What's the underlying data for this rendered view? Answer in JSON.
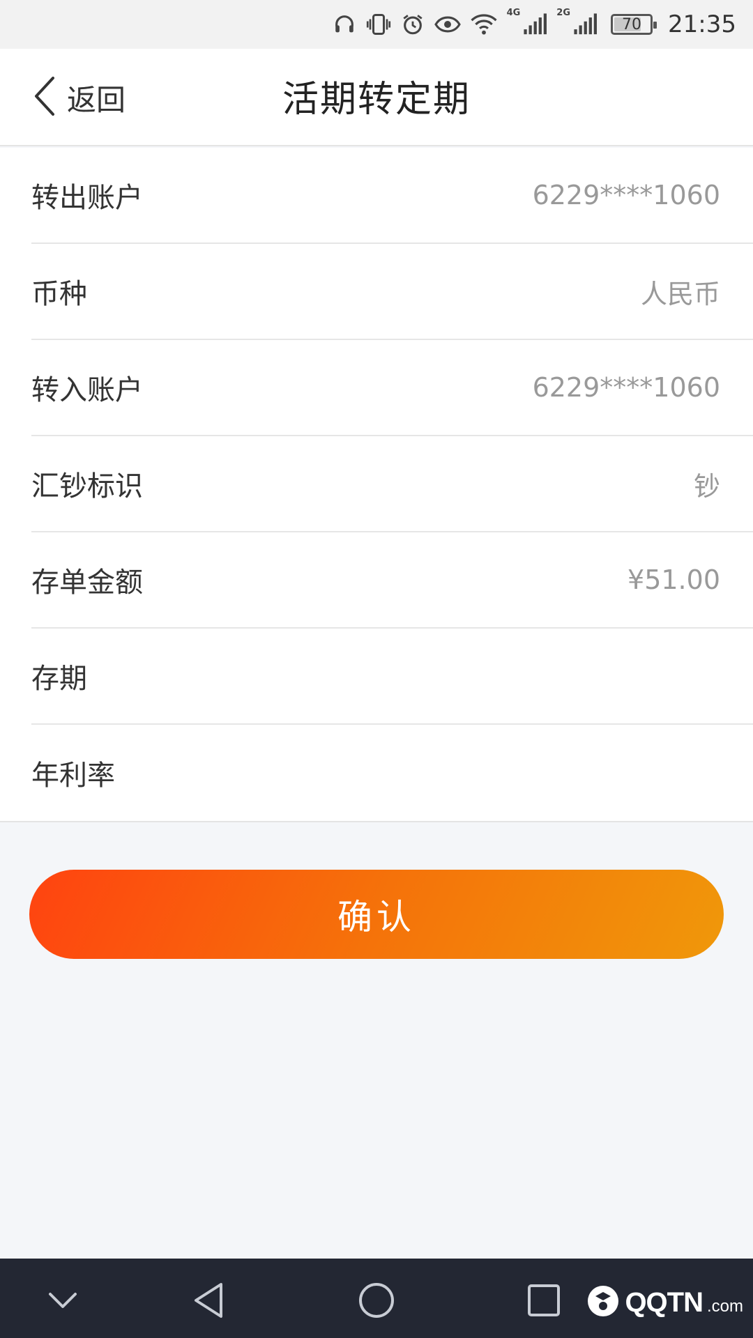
{
  "status_bar": {
    "icons": [
      "headphones-icon",
      "vibrate-icon",
      "alarm-icon",
      "eye-icon",
      "wifi-icon"
    ],
    "network_1": "4G",
    "network_2": "2G",
    "battery_level": "70",
    "time": "21:35"
  },
  "header": {
    "back_label": "返回",
    "title": "活期转定期"
  },
  "form": {
    "rows": [
      {
        "label": "转出账户",
        "value": "6229****1060"
      },
      {
        "label": "币种",
        "value": "人民币"
      },
      {
        "label": "转入账户",
        "value": "6229****1060"
      },
      {
        "label": "汇钞标识",
        "value": "钞"
      },
      {
        "label": "存单金额",
        "value": "¥51.00"
      },
      {
        "label": "存期",
        "value": ""
      },
      {
        "label": "年利率",
        "value": ""
      }
    ]
  },
  "confirm_label": "确认",
  "nav_bar": {
    "buttons": [
      "collapse-icon",
      "back-icon",
      "home-icon",
      "recents-icon"
    ]
  },
  "watermark": {
    "brand": "QQTN",
    "suffix": ".com"
  },
  "colors": {
    "accent_start": "#ff4310",
    "accent_end": "#f0980a",
    "nav_bg": "#232733",
    "page_bg": "#f4f6f9"
  }
}
